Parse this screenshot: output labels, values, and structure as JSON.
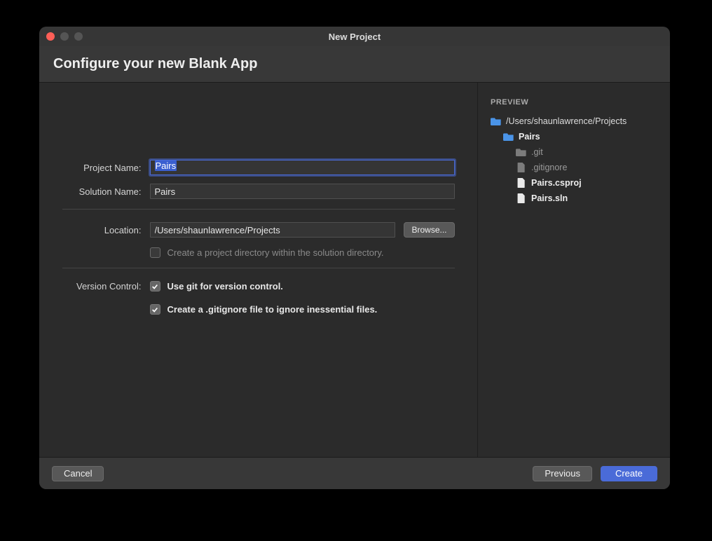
{
  "window": {
    "title": "New Project"
  },
  "header": {
    "title": "Configure your new Blank App"
  },
  "form": {
    "project_name_label": "Project Name:",
    "project_name_value": "Pairs",
    "solution_name_label": "Solution Name:",
    "solution_name_value": "Pairs",
    "location_label": "Location:",
    "location_value": "/Users/shaunlawrence/Projects",
    "browse_label": "Browse...",
    "create_dir_label": "Create a project directory within the solution directory.",
    "create_dir_checked": false,
    "version_control_label": "Version Control:",
    "use_git_label": "Use git for version control.",
    "use_git_checked": true,
    "gitignore_label": "Create a .gitignore file to ignore inessential files.",
    "gitignore_checked": true
  },
  "preview": {
    "title": "PREVIEW",
    "items": [
      {
        "type": "folder",
        "name": "/Users/shaunlawrence/Projects",
        "indent": 0,
        "color": "#4a94e8"
      },
      {
        "type": "folder",
        "name": "Pairs",
        "indent": 1,
        "color": "#4a94e8",
        "bold": true
      },
      {
        "type": "folder",
        "name": ".git",
        "indent": 2,
        "color": "#7c7c7c"
      },
      {
        "type": "file",
        "name": ".gitignore",
        "indent": 2,
        "color": "#7c7c7c"
      },
      {
        "type": "file",
        "name": "Pairs.csproj",
        "indent": 2,
        "color": "#eaeaea",
        "bold": true
      },
      {
        "type": "file",
        "name": "Pairs.sln",
        "indent": 2,
        "color": "#eaeaea",
        "bold": true
      }
    ]
  },
  "footer": {
    "cancel": "Cancel",
    "previous": "Previous",
    "create": "Create"
  }
}
